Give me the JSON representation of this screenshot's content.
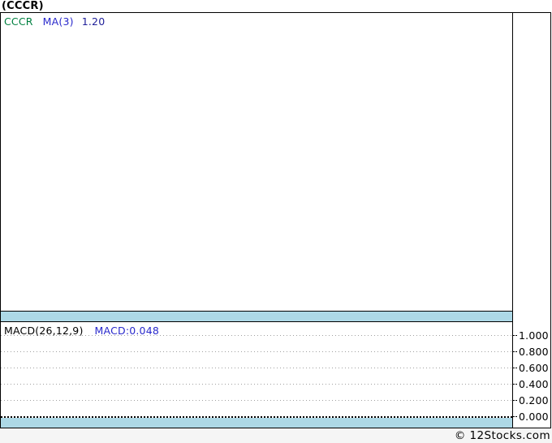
{
  "page": {
    "title": "(CCCR)",
    "footer_credit": "© 12Stocks.com"
  },
  "colors": {
    "band_blue": "#ADD8E6",
    "ticker_green": "#008040",
    "legend_blue": "#2929CC",
    "value_navy": "#202099",
    "grid_gray": "#A0A0A0",
    "border_black": "#000000",
    "footer_bg": "#F5F5F5"
  },
  "price_panel": {
    "legend": {
      "ticker": "CCCR",
      "ma_label": "MA(3)",
      "ma_value": "1.20"
    }
  },
  "macd_panel": {
    "indicator_label": "MACD(26,12,9)",
    "indicator_value": "MACD:0.048"
  },
  "chart_data": [
    {
      "type": "line",
      "title": "(CCCR) price panel",
      "legend": [
        "CCCR",
        "MA(3)"
      ],
      "last_values": {
        "MA(3)": 1.2
      },
      "series": [],
      "notes": "price pane is empty (no plotted points visible); light blue band along bottom"
    },
    {
      "type": "line",
      "title": "MACD(26,12,9)",
      "last_values": {
        "MACD": 0.048
      },
      "ylim": [
        0.0,
        1.0
      ],
      "ytick_step": 0.2,
      "yticks": [
        "1.000",
        "0.800",
        "0.600",
        "0.400",
        "0.200",
        "0.000"
      ],
      "grid": true,
      "legend_position": "top-left",
      "series": [],
      "notes": "dotted horizontal gridlines; dense black dotted zero line; light blue band along bottom"
    }
  ]
}
